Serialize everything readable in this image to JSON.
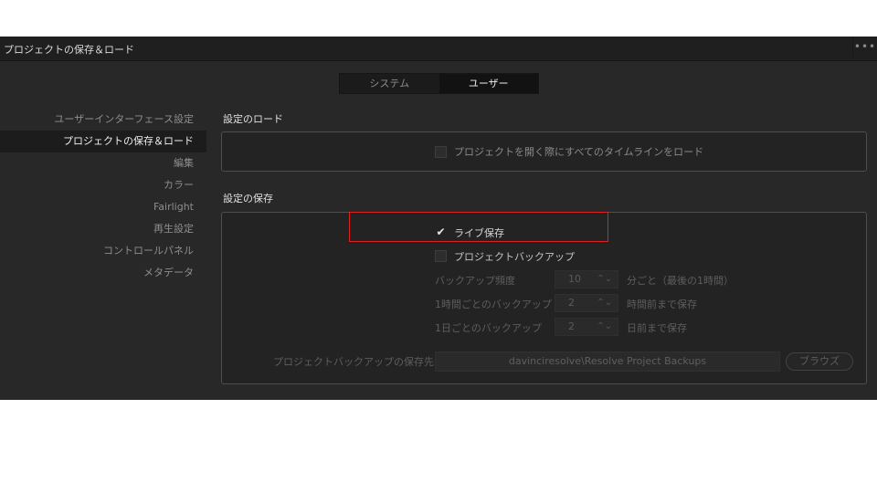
{
  "window": {
    "title": "プロジェクトの保存＆ロード",
    "menu_icon": "more-dots-icon",
    "menu_glyph": "•••"
  },
  "tabs": [
    {
      "label": "システム",
      "active": false
    },
    {
      "label": "ユーザー",
      "active": true
    }
  ],
  "sidebar": {
    "items": [
      {
        "label": "ユーザーインターフェース設定"
      },
      {
        "label": "プロジェクトの保存＆ロード",
        "active": true
      },
      {
        "label": "編集"
      },
      {
        "label": "カラー"
      },
      {
        "label": "Fairlight"
      },
      {
        "label": "再生設定"
      },
      {
        "label": "コントロールパネル"
      },
      {
        "label": "メタデータ"
      }
    ]
  },
  "load_settings": {
    "heading": "設定のロード",
    "load_all_timelines": {
      "label": "プロジェクトを開く際にすべてのタイムラインをロード",
      "checked": false
    }
  },
  "save_settings": {
    "heading": "設定の保存",
    "live_save": {
      "label": "ライブ保存",
      "checked": true,
      "check_glyph": "✔"
    },
    "project_backup": {
      "label": "プロジェクトバックアップ",
      "checked": false
    },
    "backup_frequency": {
      "label": "バックアップ頻度",
      "value": "10",
      "unit": "分ごと（最後の1時間）"
    },
    "hourly_backup": {
      "label": "1時間ごとのバックアップ",
      "value": "2",
      "unit": "時間前まで保存"
    },
    "daily_backup": {
      "label": "1日ごとのバックアップ",
      "value": "2",
      "unit": "日前まで保存"
    },
    "backup_location": {
      "label": "プロジェクトバックアップの保存先",
      "value": "davinciresolve\\Resolve Project Backups",
      "browse_label": "ブラウズ"
    },
    "spinner_glyph": "⌃⌄"
  },
  "colors": {
    "highlight": "#e02020"
  }
}
